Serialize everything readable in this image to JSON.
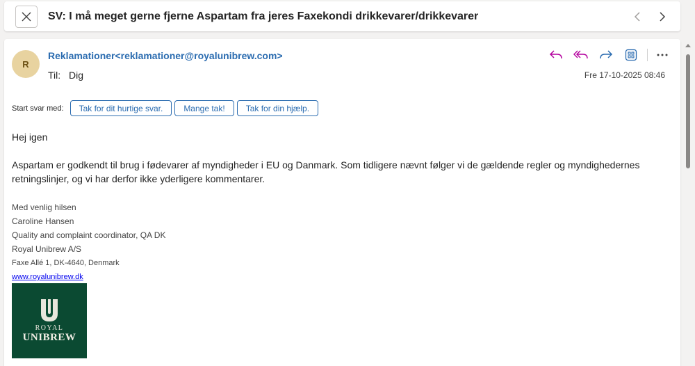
{
  "subject": "SV: I må meget gerne fjerne Aspartam fra jeres Faxekondi drikkevarer/drikkevarer",
  "message": {
    "avatar_initial": "R",
    "from": "Reklamationer<reklamationer@royalunibrew.com>",
    "to_label": "Til:",
    "to_value": "Dig",
    "datetime": "Fre 17-10-2025 08:46"
  },
  "quick_replies": {
    "label": "Start svar med:",
    "options": [
      "Tak for dit hurtige svar.",
      "Mange tak!",
      "Tak for din hjælp."
    ]
  },
  "body": {
    "greeting": "Hej igen",
    "paragraph": "Aspartam er godkendt til brug i fødevarer af myndigheder i EU og Danmark. Som tidligere nævnt følger vi de gældende regler og myndighedernes retningslinjer, og vi har derfor ikke yderligere kommentarer."
  },
  "signature": {
    "closing": "Med venlig hilsen",
    "name": "Caroline Hansen",
    "title": "Quality and complaint coordinator, QA DK",
    "company": "Royal Unibrew A/S",
    "address": "Faxe Allé 1, DK-4640, Denmark",
    "website": "www.royalunibrew.dk",
    "logo_line1": "ROYAL",
    "logo_line2": "UNIBREW"
  },
  "icons": {
    "close": "close-icon",
    "prev": "chevron-left-icon",
    "next": "chevron-right-icon",
    "reply": "reply-icon",
    "reply_all": "reply-all-icon",
    "forward": "forward-icon",
    "apps": "apps-icon",
    "more": "more-icon"
  },
  "colors": {
    "accent": "#2b6cb0",
    "reply_icon": "#b4009e",
    "forward_icon": "#2b6cb0",
    "logo_bg": "#0b4a32",
    "avatar_bg": "#e8d3a0"
  }
}
